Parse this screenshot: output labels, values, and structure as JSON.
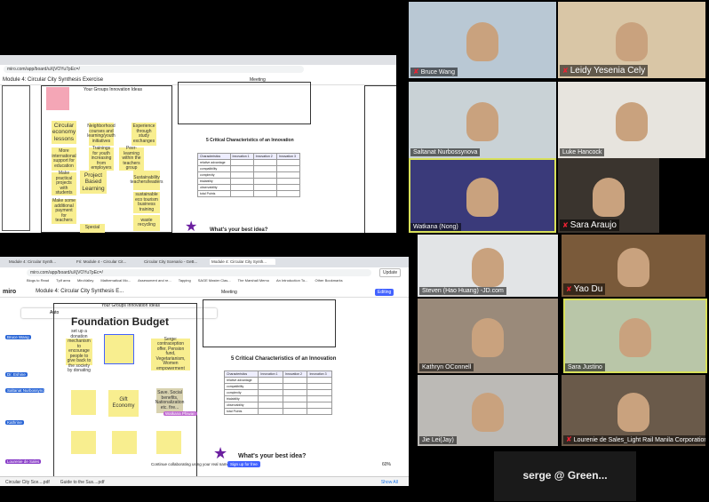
{
  "participants": [
    {
      "name": "Bruce Wang",
      "muted": true
    },
    {
      "name": "Leidy Yesenia Cely",
      "muted": true
    },
    {
      "name": "Saltanat Nurbossynova",
      "muted": false
    },
    {
      "name": "Luke Hancock",
      "muted": false
    },
    {
      "name": "Watkana (Nong)",
      "muted": false
    },
    {
      "name": "Sara Araujo",
      "muted": true
    },
    {
      "name": "Steven (Hao Huang) -JD.com",
      "muted": false
    },
    {
      "name": "Yao Du",
      "muted": true
    },
    {
      "name": "Kathryn OConnell",
      "muted": false
    },
    {
      "name": "Sara Justino",
      "muted": false
    },
    {
      "name": "Jie Lei(Jay)",
      "muted": false
    },
    {
      "name": "Lourenie de Sales_Light Rail Manila Corporation",
      "muted": true
    },
    {
      "name": "serge @  Green...",
      "muted": false
    }
  ],
  "screen1": {
    "url": "miro.com/app/board/uXjVOYu7pEc=/",
    "board_title": "Module 4: Circular City Synthesis Exercise",
    "meeting_label": "Meeting",
    "group_ideas_title": "Your Groups Innovation Ideas",
    "table_title": "5 Critical Characteristics of an Innovation",
    "best_idea": "What's your best idea?",
    "stickies": [
      "Circular economy lessons",
      "More international support for education",
      "Make practical projects with students",
      "Make some additional payment for teachers",
      "Project Based Learning",
      "Neighborhood courses and learning/youth initiatives",
      "Trainings for youth increasing from employers",
      "Peer-learning within the teachers group",
      "Experience through study exchanges",
      "Sustainability teachers/leaders",
      "sustainable eco tourism business training",
      "waste recycling",
      "Special"
    ],
    "table_rows": [
      "Characteristics",
      "relative advantage",
      "compatibility",
      "complexity",
      "trialability",
      "observability",
      "total Points"
    ],
    "table_cols": [
      "Innovation 1",
      "Innovation 2",
      "Innovation 3"
    ]
  },
  "screen2": {
    "tabs": [
      "Module 4: Circular Synth...",
      "Fri: Module 4 - Circular Cit...",
      "Circular City Scenario - GeB...",
      "Module 4: Circular City Synth..."
    ],
    "url": "miro.com/app/board/uXjVOYu7pEc=/",
    "bookmarks": [
      "Blogs to Read",
      "Tplf area",
      "MiroValley",
      "Mathematical Mo...",
      "Assessment and re...",
      "Tapping",
      "SAGE Master Clas...",
      "The Marshall Memo",
      "An Introduction To...",
      "Other Bookmarks"
    ],
    "update_label": "Update",
    "app_logo": "miro",
    "board_title": "Module 4: Circular City Synthesis E...",
    "meeting_label": "Meeting",
    "editing_label": "Editing",
    "zoom_text": "Auto",
    "heading": "Foundation Budget",
    "group_ideas_title": "Your Groups Innovation Ideas",
    "gift_economy": "Gift Economy",
    "serge_note": "Serge: contraception offer, Pension fund, Vegetarianism, Women empowerment",
    "social_note": "Save. Social benefits, Nationalization etc. fire...",
    "note1": "set up a donation mechanism to encourage people to give back to the society by donating",
    "table_title": "5 Critical Characteristics of an Innovation",
    "best_idea": "What's your best idea?",
    "continue_text": "Continue collaborating using your real name",
    "signup_label": "Sign up for free",
    "zoom_level": "60%",
    "name_tags": [
      "Bruce Wang",
      "Dr. Eshine",
      "Saltanat Nurbossynova",
      "Kathrine",
      "Lourenie de Sales"
    ],
    "cursor_tag": "Watkana Phiwan",
    "downloads": [
      "Circular City Sce....pdf",
      "Guide to the Sus....pdf"
    ],
    "show_all": "Show All"
  }
}
